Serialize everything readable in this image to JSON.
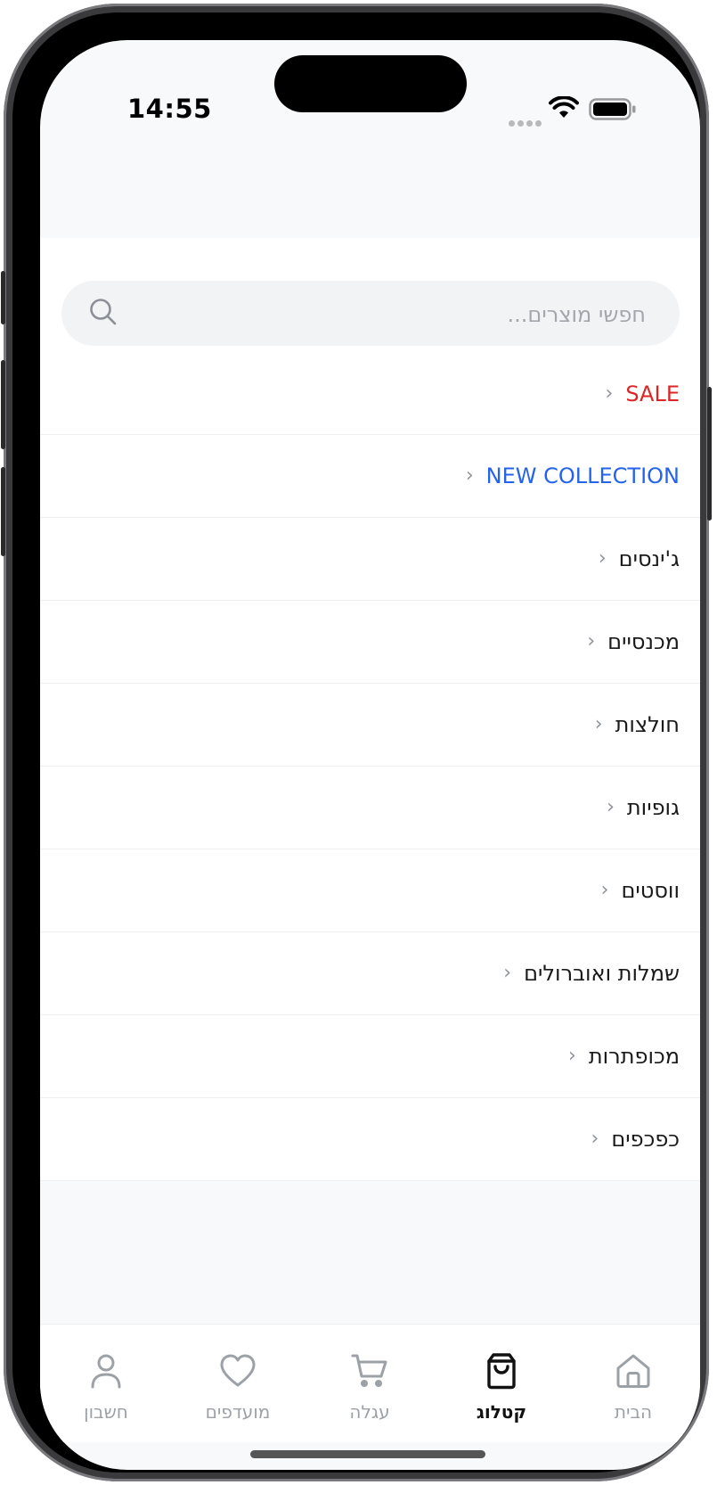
{
  "status_bar": {
    "time": "14:55"
  },
  "search": {
    "placeholder": "חפשי מוצרים..."
  },
  "categories": [
    {
      "label": "SALE",
      "color": "#dc2626"
    },
    {
      "label": "NEW COLLECTION",
      "color": "#2563eb"
    },
    {
      "label": "ג'ינסים",
      "color": "#1a1a1a"
    },
    {
      "label": "מכנסיים",
      "color": "#1a1a1a"
    },
    {
      "label": "חולצות",
      "color": "#1a1a1a"
    },
    {
      "label": "גופיות",
      "color": "#1a1a1a"
    },
    {
      "label": "ווסטים",
      "color": "#1a1a1a"
    },
    {
      "label": "שמלות ואוברולים",
      "color": "#1a1a1a"
    },
    {
      "label": "מכופתרות",
      "color": "#1a1a1a"
    },
    {
      "label": "כפכפים",
      "color": "#1a1a1a"
    }
  ],
  "chevron": "›",
  "tabs": [
    {
      "label": "חשבון",
      "icon": "user-icon",
      "active": false
    },
    {
      "label": "מועדפים",
      "icon": "heart-icon",
      "active": false
    },
    {
      "label": "עגלה",
      "icon": "cart-icon",
      "active": false
    },
    {
      "label": "קטלוג",
      "icon": "shopping-bag-icon",
      "active": true
    },
    {
      "label": "הבית",
      "icon": "home-icon",
      "active": false
    }
  ]
}
